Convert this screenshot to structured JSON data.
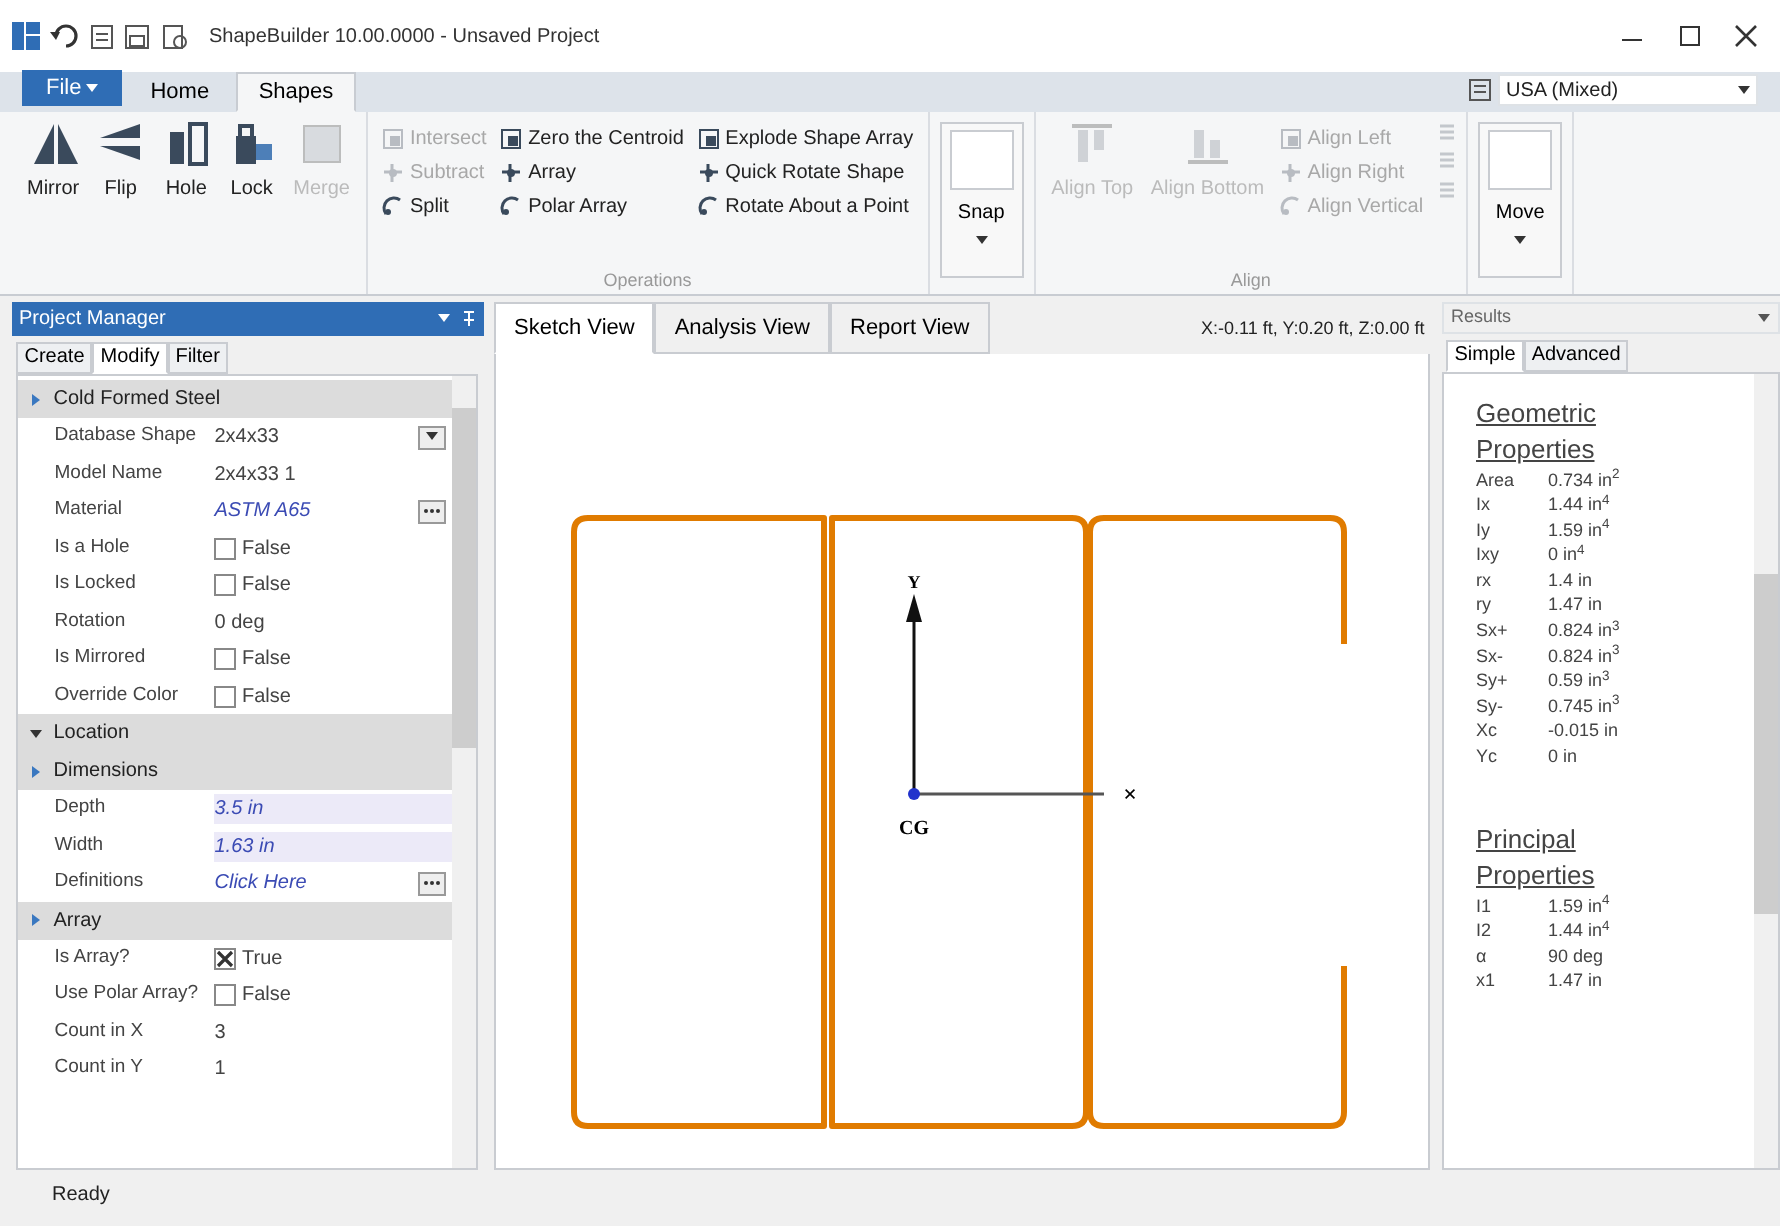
{
  "window": {
    "title": "ShapeBuilder 10.00.0000 - Unsaved Project"
  },
  "ribbon": {
    "file_button": "File",
    "tabs": [
      {
        "label": "Home",
        "selected": false
      },
      {
        "label": "Shapes",
        "selected": true
      }
    ],
    "units": "USA (Mixed)",
    "groups": [
      {
        "items": [
          {
            "kind": "large",
            "label": "Mirror",
            "disabled": false
          },
          {
            "kind": "large",
            "label": "Flip",
            "disabled": false
          },
          {
            "kind": "large",
            "label": "Hole",
            "disabled": false
          },
          {
            "kind": "large",
            "label": "Lock",
            "disabled": false
          },
          {
            "kind": "large",
            "label": "Merge",
            "disabled": true
          }
        ]
      },
      {
        "label": "Operations",
        "items": [
          {
            "kind": "column",
            "items": [
              {
                "label": "Intersect",
                "disabled": true
              },
              {
                "label": "Subtract",
                "disabled": true
              },
              {
                "label": "Split",
                "disabled": false
              }
            ]
          },
          {
            "kind": "column",
            "items": [
              {
                "label": "Zero the Centroid",
                "disabled": false
              },
              {
                "label": "Array",
                "disabled": false
              },
              {
                "label": "Polar Array",
                "disabled": false
              }
            ]
          },
          {
            "kind": "column",
            "items": [
              {
                "label": "Explode Shape Array",
                "disabled": false
              },
              {
                "label": "Quick Rotate Shape",
                "disabled": false
              },
              {
                "label": "Rotate About a Point",
                "disabled": false
              }
            ]
          }
        ]
      },
      {
        "items": [
          {
            "kind": "split",
            "label": "Snap"
          }
        ]
      },
      {
        "label": "Align",
        "items": [
          {
            "kind": "large",
            "label": "Align Top",
            "disabled": true
          },
          {
            "kind": "large",
            "label": "Align Bottom",
            "disabled": true
          },
          {
            "kind": "column",
            "items": [
              {
                "label": "Align Left",
                "disabled": true
              },
              {
                "label": "Align Right",
                "disabled": true
              },
              {
                "label": "Align Vertical",
                "disabled": true
              }
            ]
          }
        ]
      },
      {
        "items": [
          {
            "kind": "split",
            "label": "Move"
          }
        ]
      }
    ]
  },
  "project_manager": {
    "title": "Project Manager",
    "tabs": [
      {
        "label": "Create",
        "selected": false
      },
      {
        "label": "Modify",
        "selected": true
      },
      {
        "label": "Filter",
        "selected": false
      }
    ],
    "sections": [
      {
        "title": "Cold Formed Steel",
        "expanded": false,
        "rows": [
          {
            "name": "Database Shape",
            "value": "2x4x33",
            "kind": "dropdown"
          },
          {
            "name": "Model Name",
            "value": "2x4x33 1",
            "kind": "text"
          },
          {
            "name": "Material",
            "value": "ASTM A65",
            "kind": "ellipsis"
          },
          {
            "name": "Is a Hole",
            "value": "False",
            "kind": "checkbox",
            "checked": false
          },
          {
            "name": "Is Locked",
            "value": "False",
            "kind": "checkbox",
            "checked": false
          },
          {
            "name": "Rotation",
            "value": "0 deg",
            "kind": "text"
          },
          {
            "name": "Is Mirrored",
            "value": "False",
            "kind": "checkbox",
            "checked": false
          },
          {
            "name": "Override Color",
            "value": "False",
            "kind": "checkbox",
            "checked": false
          }
        ]
      },
      {
        "title": "Location",
        "expanded": true
      },
      {
        "title": "Dimensions",
        "expanded": false,
        "rows": [
          {
            "name": "Depth",
            "value": "3.5 in",
            "kind": "input"
          },
          {
            "name": "Width",
            "value": "1.63 in",
            "kind": "input"
          },
          {
            "name": "Definitions",
            "value": "Click Here",
            "kind": "ellipsis"
          }
        ]
      },
      {
        "title": "Array",
        "expanded": false,
        "rows": [
          {
            "name": "Is Array?",
            "value": "True",
            "kind": "checkbox",
            "checked": true
          },
          {
            "name": "Use Polar Array?",
            "value": "False",
            "kind": "checkbox",
            "checked": false
          },
          {
            "name": "Count in X",
            "value": "3",
            "kind": "text"
          },
          {
            "name": "Count in Y",
            "value": "1",
            "kind": "text"
          }
        ]
      }
    ]
  },
  "views": {
    "tabs": [
      {
        "label": "Sketch View",
        "selected": true
      },
      {
        "label": "Analysis View",
        "selected": false
      },
      {
        "label": "Report View",
        "selected": false
      }
    ],
    "coordinates": "X:-0.11 ft, Y:0.20 ft, Z:0.00 ft",
    "axis_labels": {
      "x": "×",
      "y": "Y",
      "origin": "CG"
    }
  },
  "results": {
    "title": "Results",
    "tabs": [
      {
        "label": "Simple",
        "selected": true
      },
      {
        "label": "Advanced",
        "selected": false
      }
    ],
    "sections": [
      {
        "title": "Geometric Properties",
        "rows": [
          {
            "label": "Area",
            "value": "0.734 in$^{2}$"
          },
          {
            "label": "Ix",
            "value": "1.44 in$^{4}$"
          },
          {
            "label": "Iy",
            "value": "1.59 in$^{4}$"
          },
          {
            "label": "Ixy",
            "value": "0 in$^{4}$"
          },
          {
            "label": "rx",
            "value": "1.4 in"
          },
          {
            "label": "ry",
            "value": "1.47 in"
          },
          {
            "label": "Sx+",
            "value": "0.824 in$^{3}$"
          },
          {
            "label": "Sx-",
            "value": "0.824 in$^{3}$"
          },
          {
            "label": "Sy+",
            "value": "0.59 in$^{3}$"
          },
          {
            "label": "Sy-",
            "value": "0.745 in$^{3}$"
          },
          {
            "label": "Xc",
            "value": "-0.015 in"
          },
          {
            "label": "Yc",
            "value": "0 in"
          }
        ]
      },
      {
        "title": "Principal Properties",
        "rows": [
          {
            "label": "I1",
            "value": "1.59 in$^{4}$"
          },
          {
            "label": "I2",
            "value": "1.44 in$^{4}$"
          },
          {
            "label": "α",
            "value": "90 deg"
          },
          {
            "label": "x1",
            "value": "1.47 in"
          }
        ]
      }
    ]
  },
  "status_bar": "Ready"
}
